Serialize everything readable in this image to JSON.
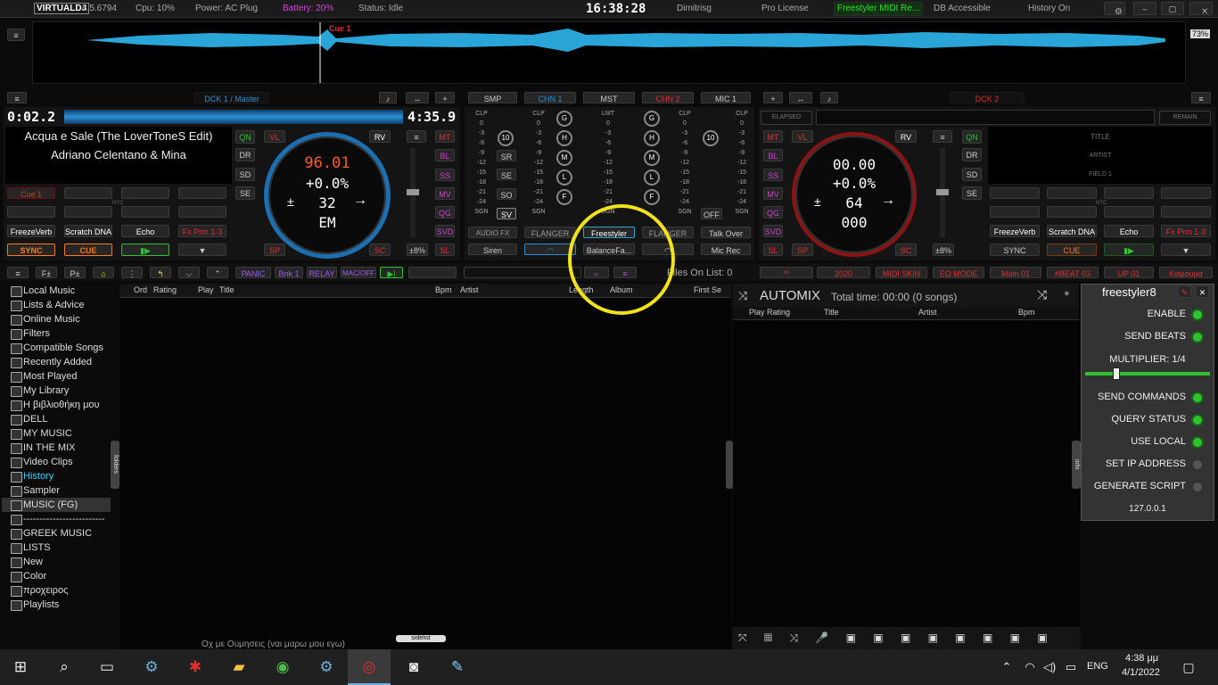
{
  "topbar": {
    "logo": "VIRTUALDJ",
    "version": "8.5.6794",
    "cpu": "Cpu: 10%",
    "power": "Power: AC Plug",
    "battery": "Battery: 20%",
    "status": "Status: Idle",
    "clock": "16:38:28",
    "user": "Dimitrisg",
    "license": "Pro License",
    "midi": "Freestyler MIDI Re...",
    "db": "DB Accessible",
    "history": "History On"
  },
  "waveform": {
    "cue_label": "Cue 1",
    "zoom": "73%"
  },
  "colors": {
    "accent_blue": "#2a8fd6",
    "accent_red": "#e03030",
    "accent_green": "#2fc12f",
    "orange": "#ff7a1a",
    "highlight_circle": "#f2e21a"
  },
  "deck1": {
    "header": "DCK 1 / Master",
    "elapsed": "0:02.2",
    "remain": "4:35.9",
    "title": "Acqua e Sale (The LoverToneS Edit)",
    "artist": "Adriano Celentano & Mina",
    "bpm": "96.01",
    "pitch": "+0.0%",
    "beats": "32",
    "key": "EM",
    "pads": [
      "Cue 1",
      "",
      "",
      ""
    ],
    "fx": [
      "FreezeVerb",
      "Scratch DNA",
      "Echo",
      "Fx Prm 1-3"
    ],
    "btns": {
      "qn": "QN",
      "dr": "DR",
      "sd": "SD",
      "se": "SE",
      "vl": "VL",
      "rv": "RV",
      "mt": "MT",
      "bl": "BL",
      "ss": "SS",
      "mv": "MV",
      "qg": "QG",
      "svd": "SVD",
      "sl": "SL",
      "sp": "SP",
      "sc": "SC",
      "pitch_range": "±8%",
      "sync": "SYNC",
      "cue": "CUE",
      "hotcue": "HTC"
    }
  },
  "deck2": {
    "header": "DCK 2",
    "elapsed": "ELAPSED",
    "remain": "REMAIN",
    "title": "TITLE",
    "artist": "ARTIST",
    "field": "FIELD 1",
    "bpm": "00.00",
    "pitch": "+0.0%",
    "beats": "64",
    "key": "000",
    "fx": [
      "FreezeVerb",
      "Scratch DNA",
      "Echo",
      "Fx Prm 1-3"
    ],
    "btns": {
      "qn": "QN",
      "dr": "DR",
      "sd": "SD",
      "se": "SE",
      "vl": "VL",
      "rv": "RV",
      "mt": "MT",
      "bl": "BL",
      "ss": "SS",
      "mv": "MV",
      "qg": "QG",
      "svd": "SVD",
      "sl": "SL",
      "sp": "SP",
      "sc": "SC",
      "pitch_range": "±8%",
      "sync": "SYNC",
      "cue": "CUE",
      "hotcue": "HTC"
    }
  },
  "mixer": {
    "tabs": [
      "SMP",
      "CHN 1",
      "MST",
      "CHN 2",
      "MIC 1"
    ],
    "vu_labels": [
      "CLP",
      "0",
      "-3",
      "-6",
      "-9",
      "-12",
      "-15",
      "-18",
      "-21",
      "-24",
      "SGN"
    ],
    "mst_label": "LMT",
    "eq": [
      "G",
      "H",
      "M",
      "L",
      "F"
    ],
    "sr": "SR",
    "se": "SE",
    "so": "SO",
    "sv": "SV",
    "knob_val": "10",
    "off": "OFF",
    "audio_fx": "AUDIO FX",
    "flanger1": "FLANGER",
    "freestyler": "Freestyler",
    "flanger2": "FLANGER",
    "talkover": "Talk Over",
    "siren": "Siren",
    "balance": "BalanceFa...",
    "micrec": "Mic Rec"
  },
  "bottombar": {
    "left": [
      "≡",
      "F±",
      "P±",
      "⌂",
      "⋮",
      "↰",
      "⌵",
      "⌃"
    ],
    "panic": "PANIC",
    "bnk": "Bnk 1",
    "relay": "RELAY",
    "macoff": "MAC/OFF",
    "files_on_list": "Files On List: 0",
    "right": [
      "**",
      "2020",
      "MIDI SKIN",
      "EQ MODE",
      "Main 01",
      "#BEAT 03",
      "UP 01",
      "Καψουρα"
    ]
  },
  "browser": {
    "tree": [
      "Local Music",
      "Lists & Advice",
      "Online Music",
      "Filters",
      "Compatible Songs",
      "Recently Added",
      "Most Played",
      "My Library",
      "Η βιβλιοθήκη μου",
      "DELL",
      "MY MUSIC",
      "IN THE MIX",
      "Video Clips",
      "History",
      "Sampler",
      "MUSIC (FG)",
      "-------------------------",
      "GREEK MUSIC",
      "LISTS",
      "New",
      "Color",
      "προχειρος",
      "Playlists"
    ],
    "columns": [
      "Ord",
      "Rating",
      "Play",
      "Title",
      "Bpm",
      "Artist",
      "Length",
      "Album",
      "First Se"
    ],
    "folders_tab": "folders",
    "sidelist_tab": "sidelist",
    "info_tab": "info",
    "partial_row": "Οχ με Ουμησεις (ναι μαρω μου εγω)"
  },
  "automix": {
    "title": "AUTOMIX",
    "total": "Total time: 00:00 (0 songs)",
    "columns": [
      "Play",
      "Rating",
      "Title",
      "Artist",
      "Bpm"
    ]
  },
  "freestyler": {
    "title": "freestyler8",
    "rows": [
      {
        "label": "ENABLE",
        "on": true
      },
      {
        "label": "SEND BEATS",
        "on": true
      }
    ],
    "multiplier": "MULTIPLIER: 1/4",
    "rows2": [
      {
        "label": "SEND COMMANDS",
        "on": true
      },
      {
        "label": "QUERY STATUS",
        "on": true
      },
      {
        "label": "USE LOCAL",
        "on": true
      },
      {
        "label": "SET IP ADDRESS",
        "on": false
      },
      {
        "label": "GENERATE SCRIPT",
        "on": false
      }
    ],
    "ip": "127.0.0.1"
  },
  "taskbar": {
    "time": "4:38 μμ",
    "date": "4/1/2022",
    "lang": "ENG"
  }
}
